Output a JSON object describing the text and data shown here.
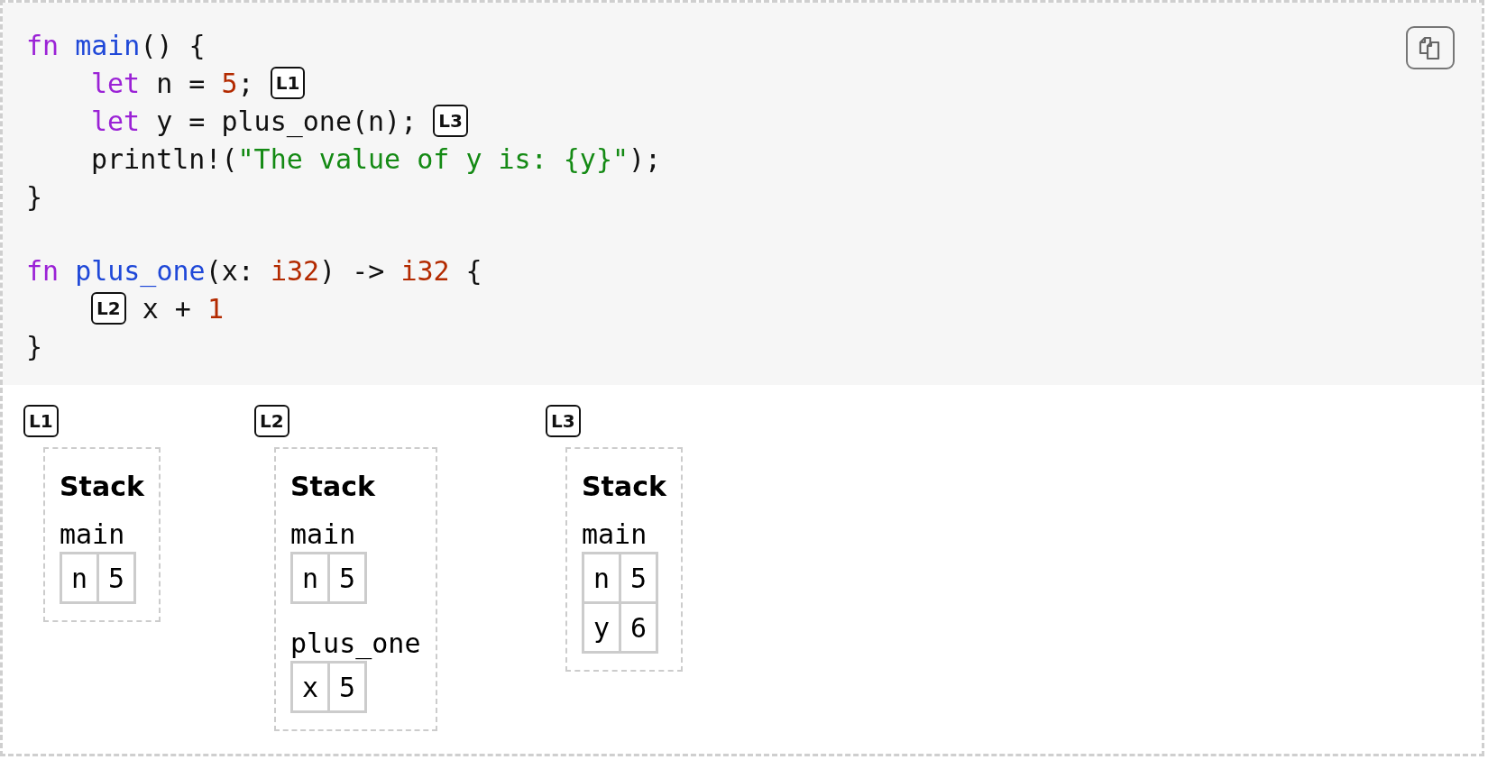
{
  "code": {
    "blocks": [
      {
        "tokens": [
          {
            "kind": "keyword",
            "text": "fn"
          },
          {
            "kind": "function",
            "text": "main"
          },
          {
            "kind": "plain",
            "text": "() {"
          }
        ],
        "children": [
          {
            "tokens": [
              {
                "kind": "keyword",
                "text": "let"
              },
              {
                "kind": "plain",
                "text": " n = "
              },
              {
                "kind": "number",
                "text": "5"
              },
              {
                "kind": "plain",
                "text": "; "
              },
              {
                "kind": "marker",
                "text": "L1"
              }
            ]
          },
          {
            "tokens": [
              {
                "kind": "keyword",
                "text": "let"
              },
              {
                "kind": "plain",
                "text": " y = plus_one(n); "
              },
              {
                "kind": "marker",
                "text": "L3"
              }
            ]
          },
          {
            "tokens": [
              {
                "kind": "plain",
                "text": "println!("
              },
              {
                "kind": "string",
                "text": "\"The value of y is: {y}\""
              },
              {
                "kind": "plain",
                "text": ");"
              }
            ]
          }
        ],
        "end": {
          "tokens": [
            {
              "kind": "plain",
              "text": "}"
            }
          ]
        }
      },
      {
        "tokens": [
          {
            "kind": "keyword",
            "text": "fn"
          },
          {
            "kind": "function",
            "text": "plus_one"
          },
          {
            "kind": "plain",
            "text": "(x: "
          },
          {
            "kind": "number",
            "text": "i32"
          },
          {
            "kind": "plain",
            "text": ") -> "
          },
          {
            "kind": "number",
            "text": "i32"
          },
          {
            "kind": "plain",
            "text": " {"
          }
        ],
        "children": [
          {
            "tokens": [
              {
                "kind": "marker",
                "text": "L2"
              },
              {
                "kind": "plain",
                "text": " x + "
              },
              {
                "kind": "number",
                "text": "1"
              }
            ]
          }
        ],
        "end": {
          "tokens": [
            {
              "kind": "plain",
              "text": "}"
            }
          ]
        }
      }
    ]
  },
  "diagrams": [
    {
      "marker": "L1",
      "title": "Stack",
      "frames": [
        {
          "name": "main",
          "vars": [
            {
              "name": "n",
              "value": "5"
            }
          ]
        }
      ]
    },
    {
      "marker": "L2",
      "title": "Stack",
      "frames": [
        {
          "name": "main",
          "vars": [
            {
              "name": "n",
              "value": "5"
            }
          ]
        },
        {
          "name": "plus_one",
          "vars": [
            {
              "name": "x",
              "value": "5"
            }
          ]
        }
      ]
    },
    {
      "marker": "L3",
      "title": "Stack",
      "frames": [
        {
          "name": "main",
          "vars": [
            {
              "name": "n",
              "value": "5"
            },
            {
              "name": "y",
              "value": "6"
            }
          ]
        }
      ]
    }
  ]
}
